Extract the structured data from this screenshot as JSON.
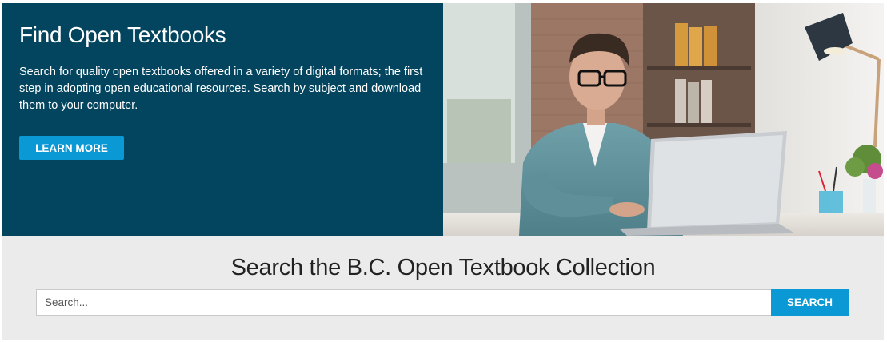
{
  "hero": {
    "title": "Find Open Textbooks",
    "description": "Search for quality open textbooks offered in a variety of digital formats; the first step in adopting open educational resources. Search by subject and download them to your computer.",
    "learn_more_label": "LEARN MORE",
    "panel_color": "#03445f",
    "photo_icon": "student-laptop-photo"
  },
  "search": {
    "heading": "Search the B.C. Open Textbook Collection",
    "placeholder": "Search...",
    "value": "",
    "button_label": "SEARCH",
    "accent_color": "#0a99d4"
  }
}
